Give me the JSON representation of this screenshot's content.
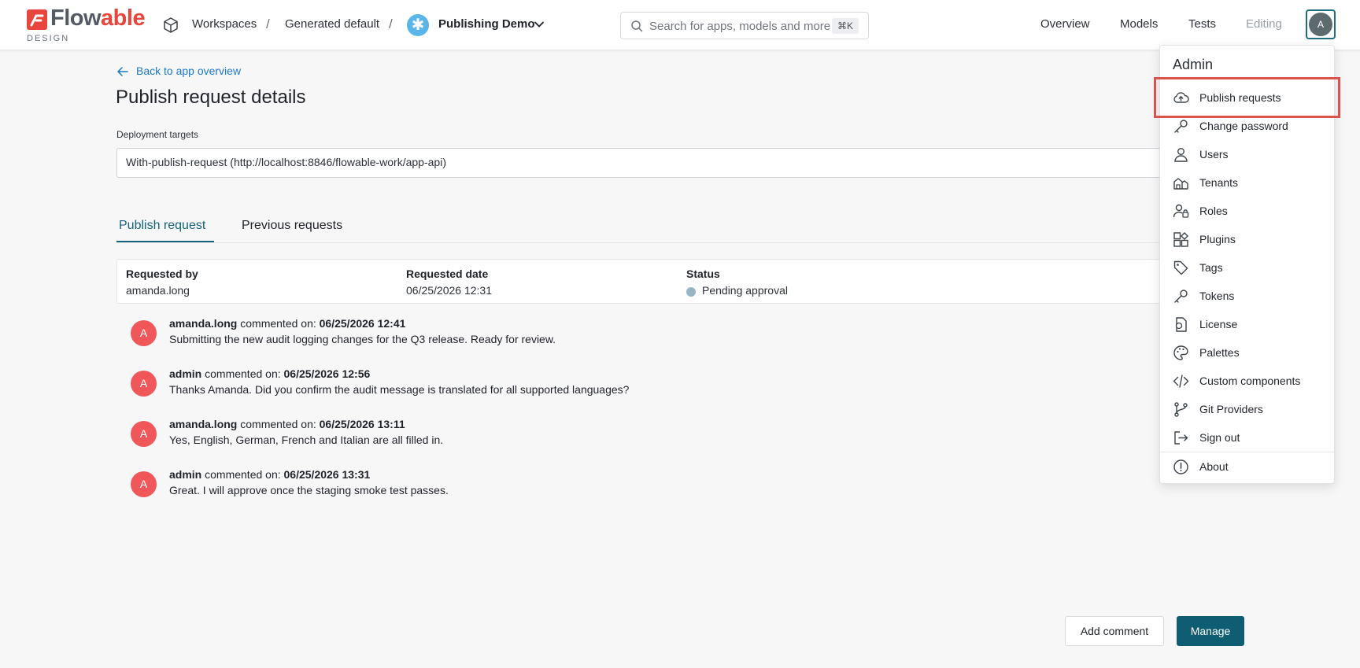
{
  "brand": {
    "name_main": "Flow",
    "name_accent": "able",
    "subtitle": "DESIGN",
    "accent_color": "#e8453c"
  },
  "breadcrumb": {
    "items": [
      "Workspaces",
      "Generated default"
    ],
    "separator": "/",
    "app": {
      "badge": "✱",
      "name": "Publishing Demo"
    }
  },
  "search": {
    "placeholder": "Search for apps, models and more",
    "shortcut": "⌘K"
  },
  "topnav": {
    "items": [
      "Overview",
      "Models",
      "Tests"
    ],
    "disabled_item": "Editing"
  },
  "user": {
    "avatar_letter": "A"
  },
  "page": {
    "back_link": "Back to app overview",
    "title": "Publish request details",
    "deployment_label": "Deployment targets",
    "deployment_value": "With-publish-request (http://localhost:8846/flowable-work/app-api)"
  },
  "tabs": [
    {
      "label": "Publish request",
      "active": true
    },
    {
      "label": "Previous requests",
      "active": false
    }
  ],
  "info": {
    "requested_by_label": "Requested by",
    "requested_by": "amanda.long",
    "requested_date_label": "Requested date",
    "requested_date": "06/25/2026 12:31",
    "status_label": "Status",
    "status": "Pending approval"
  },
  "comments": [
    {
      "avatar": "A",
      "author": "amanda.long",
      "verb": "commented on:",
      "date": "06/25/2026 12:41",
      "text": "Submitting the new audit logging changes for the Q3 release. Ready for review."
    },
    {
      "avatar": "A",
      "author": "admin",
      "verb": "commented on:",
      "date": "06/25/2026 12:56",
      "text": "Thanks Amanda. Did you confirm the audit message is translated for all supported languages?"
    },
    {
      "avatar": "A",
      "author": "amanda.long",
      "verb": "commented on:",
      "date": "06/25/2026 13:11",
      "text": "Yes, English, German, French and Italian are all filled in."
    },
    {
      "avatar": "A",
      "author": "admin",
      "verb": "commented on:",
      "date": "06/25/2026 13:31",
      "text": "Great. I will approve once the staging smoke test passes."
    }
  ],
  "actions": {
    "add_comment": "Add comment",
    "manage": "Manage"
  },
  "admin_menu": {
    "title": "Admin",
    "items": [
      {
        "label": "Publish requests",
        "icon": "cloud-upload-icon"
      },
      {
        "label": "Change password",
        "icon": "key-icon"
      },
      {
        "label": "Users",
        "icon": "user-icon"
      },
      {
        "label": "Tenants",
        "icon": "tenant-icon"
      },
      {
        "label": "Roles",
        "icon": "user-lock-icon"
      },
      {
        "label": "Plugins",
        "icon": "puzzle-icon"
      },
      {
        "label": "Tags",
        "icon": "tag-icon"
      },
      {
        "label": "Tokens",
        "icon": "key-icon"
      },
      {
        "label": "License",
        "icon": "license-icon"
      },
      {
        "label": "Palettes",
        "icon": "palette-icon"
      },
      {
        "label": "Custom components",
        "icon": "code-icon"
      },
      {
        "label": "Git Providers",
        "icon": "git-branch-icon"
      },
      {
        "label": "Sign out",
        "icon": "sign-out-icon"
      }
    ],
    "footer_item": {
      "label": "About",
      "icon": "info-icon"
    }
  }
}
